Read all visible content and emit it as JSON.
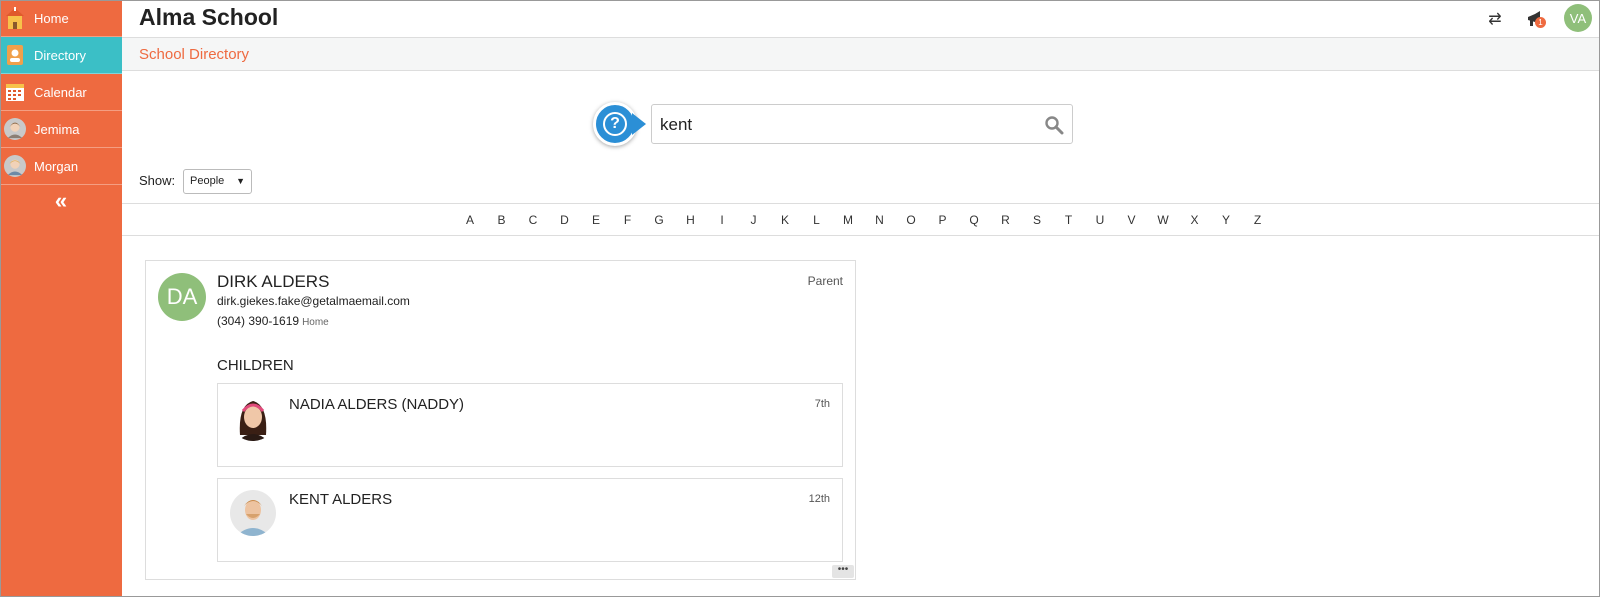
{
  "sidebar": {
    "items": [
      {
        "label": "Home",
        "icon": "school-house-icon"
      },
      {
        "label": "Directory",
        "icon": "address-book-icon"
      },
      {
        "label": "Calendar",
        "icon": "calendar-icon"
      },
      {
        "label": "Jemima",
        "icon": "student-avatar"
      },
      {
        "label": "Morgan",
        "icon": "student-avatar"
      }
    ],
    "active": "Directory",
    "collapse_label": "«"
  },
  "header": {
    "title": "Alma School",
    "swap_icon": "⇄",
    "notification_count": "1",
    "user_initials": "VA"
  },
  "breadcrumb": {
    "title": "School Directory"
  },
  "search": {
    "value": "kent",
    "help_label": "?"
  },
  "filter": {
    "label": "Show:",
    "selected": "People"
  },
  "alphabet": [
    "A",
    "B",
    "C",
    "D",
    "E",
    "F",
    "G",
    "H",
    "I",
    "J",
    "K",
    "L",
    "M",
    "N",
    "O",
    "P",
    "Q",
    "R",
    "S",
    "T",
    "U",
    "V",
    "W",
    "X",
    "Y",
    "Z"
  ],
  "result": {
    "initials": "DA",
    "name": "DIRK ALDERS",
    "role": "Parent",
    "email": "dirk.giekes.fake@getalmaemail.com",
    "phone": "(304) 390-1619",
    "phone_type": "Home",
    "children_heading": "CHILDREN",
    "children": [
      {
        "name": "NADIA ALDERS (NADDY)",
        "grade": "7th"
      },
      {
        "name": "KENT ALDERS",
        "grade": "12th"
      }
    ],
    "more_label": "•••"
  },
  "colors": {
    "brand": "#ee6a40",
    "active": "#3bbfc6",
    "avatar": "#8fbf7a",
    "help": "#2b8fd6"
  }
}
